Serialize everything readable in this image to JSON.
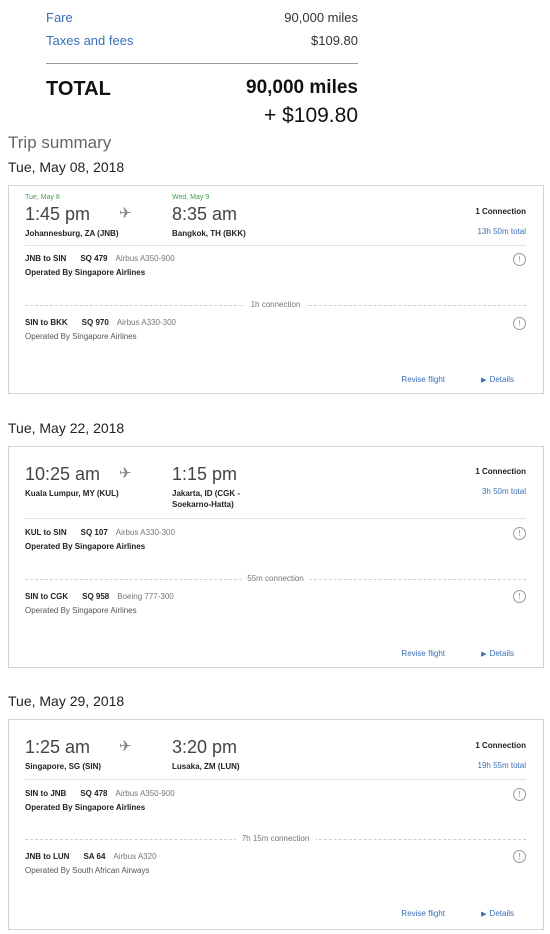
{
  "price": {
    "fare_label": "Fare",
    "fare_value": "90,000 miles",
    "taxes_label": "Taxes and fees",
    "taxes_value": "$109.80",
    "total_label": "TOTAL",
    "total_miles": "90,000 miles",
    "total_fees": "+ $109.80"
  },
  "trip_summary_title": "Trip summary",
  "colors": {
    "link": "#3a6fb5",
    "date_accent": "#4a9a4a"
  },
  "icons": {
    "plane": "airplane-icon",
    "info": "info-circle-icon",
    "details_caret": "caret-right-icon"
  },
  "trips": [
    {
      "date_heading": "Tue, May 08, 2018",
      "depart_date": "Tue, May 8",
      "arrive_date": "Wed, May 9",
      "depart_time": "1:45 pm",
      "arrive_time": "8:35 am",
      "depart_city": "Johannesburg, ZA (JNB)",
      "arrive_city": "Bangkok, TH (BKK)",
      "connections": "1 Connection",
      "duration": "13h 50m total",
      "segments": [
        {
          "route": "JNB to SIN",
          "flight": "SQ 479",
          "aircraft": "Airbus A350-900",
          "operator": "Operated By Singapore Airlines"
        },
        {
          "route": "SIN to BKK",
          "flight": "SQ 970",
          "aircraft": "Airbus A330-300",
          "operator": "Operated By Singapore Airlines"
        }
      ],
      "layover": "1h connection",
      "revise": "Revise flight",
      "details": "Details"
    },
    {
      "date_heading": "Tue, May 22, 2018",
      "depart_time": "10:25 am",
      "arrive_time": "1:15 pm",
      "depart_city": "Kuala Lumpur, MY (KUL)",
      "arrive_city_line1": "Jakarta, ID (CGK -",
      "arrive_city_line2": "Soekarno-Hatta)",
      "connections": "1 Connection",
      "duration": "3h 50m total",
      "segments": [
        {
          "route": "KUL to SIN",
          "flight": "SQ 107",
          "aircraft": "Airbus A330-300",
          "operator": "Operated By Singapore Airlines"
        },
        {
          "route": "SIN to CGK",
          "flight": "SQ 958",
          "aircraft": "Boeing 777-300",
          "operator": "Operated By Singapore Airlines"
        }
      ],
      "layover": "55m connection",
      "revise": "Revise flight",
      "details": "Details"
    },
    {
      "date_heading": "Tue, May 29, 2018",
      "depart_time": "1:25 am",
      "arrive_time": "3:20 pm",
      "depart_city": "Singapore, SG (SIN)",
      "arrive_city": "Lusaka, ZM (LUN)",
      "connections": "1 Connection",
      "duration": "19h 55m total",
      "segments": [
        {
          "route": "SIN to JNB",
          "flight": "SQ 478",
          "aircraft": "Airbus A350-900",
          "operator": "Operated By Singapore Airlines"
        },
        {
          "route": "JNB to LUN",
          "flight": "SA 64",
          "aircraft": "Airbus A320",
          "operator": "Operated By South African Airways"
        }
      ],
      "layover": "7h 15m connection",
      "revise": "Revise flight",
      "details": "Details"
    }
  ]
}
